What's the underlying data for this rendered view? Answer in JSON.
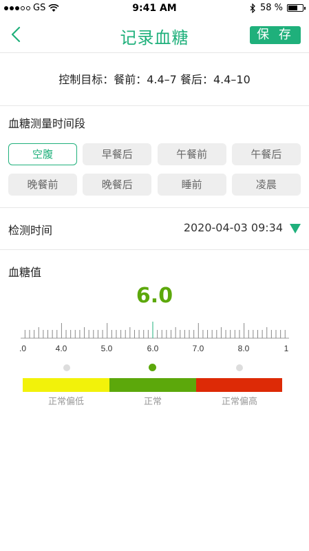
{
  "status_bar": {
    "carrier": "GS",
    "time": "9:41 AM",
    "battery_percent": "58 %",
    "battery_level": 0.58
  },
  "nav": {
    "title": "记录血糖",
    "save_label": "保 存"
  },
  "target": {
    "text": "控制目标：餐前：4.4–7 餐后：4.4–10"
  },
  "period": {
    "label": "血糖测量时间段",
    "options": [
      "空腹",
      "早餐后",
      "午餐前",
      "午餐后",
      "晚餐前",
      "晚餐后",
      "睡前",
      "凌晨"
    ],
    "selected": "空腹"
  },
  "test_time": {
    "label": "检测时间",
    "value": "2020-04-03 09:34"
  },
  "glucose": {
    "label": "血糖值",
    "value": "6.0",
    "ruler_labels": [
      ".0",
      "4.0",
      "5.0",
      "6.0",
      "7.0",
      "8.0",
      "1"
    ],
    "range_labels": [
      "正常偏低",
      "正常",
      "正常偏高"
    ],
    "active_range": "正常"
  },
  "colors": {
    "accent": "#1fb07b",
    "value_green": "#5ca80b",
    "low": "#f2f20a",
    "normal": "#5ca80b",
    "high": "#dd2a06"
  }
}
